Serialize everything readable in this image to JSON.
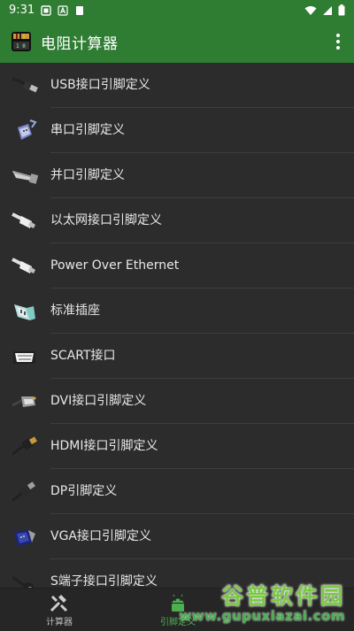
{
  "status_bar": {
    "time": "9:31",
    "icons": [
      "notification-icon",
      "a-box-icon",
      "sim-icon",
      "wifi-icon",
      "signal-icon",
      "battery-icon"
    ]
  },
  "app_bar": {
    "title": "电阻计算器",
    "logo_icon": "resistor-app-icon",
    "menu_icon": "more-vert-icon"
  },
  "list": {
    "items": [
      {
        "label": "USB接口引脚定义",
        "icon": "usb-connector-icon"
      },
      {
        "label": "串口引脚定义",
        "icon": "serial-connector-icon"
      },
      {
        "label": "并口引脚定义",
        "icon": "parallel-connector-icon"
      },
      {
        "label": "以太网接口引脚定义",
        "icon": "ethernet-connector-icon"
      },
      {
        "label": "Power Over Ethernet",
        "icon": "poe-connector-icon"
      },
      {
        "label": "标准插座",
        "icon": "standard-socket-icon"
      },
      {
        "label": "SCART接口",
        "icon": "scart-connector-icon"
      },
      {
        "label": "DVI接口引脚定义",
        "icon": "dvi-connector-icon"
      },
      {
        "label": "HDMI接口引脚定义",
        "icon": "hdmi-connector-icon"
      },
      {
        "label": "DP引脚定义",
        "icon": "displayport-connector-icon"
      },
      {
        "label": "VGA接口引脚定义",
        "icon": "vga-connector-icon"
      },
      {
        "label": "S端子接口引脚定义",
        "icon": "s-video-connector-icon"
      }
    ]
  },
  "bottom_nav": {
    "items": [
      {
        "label": "计算器",
        "icon": "tools-icon",
        "active": false
      },
      {
        "label": "引脚定义",
        "icon": "android-icon",
        "active": true
      }
    ]
  },
  "watermark": {
    "title": "谷普软件园",
    "url": "www.gupuxiazai.com"
  },
  "colors": {
    "app_bar": "#2e7d32",
    "background": "#2c2c2c",
    "accent": "#4caf50"
  }
}
